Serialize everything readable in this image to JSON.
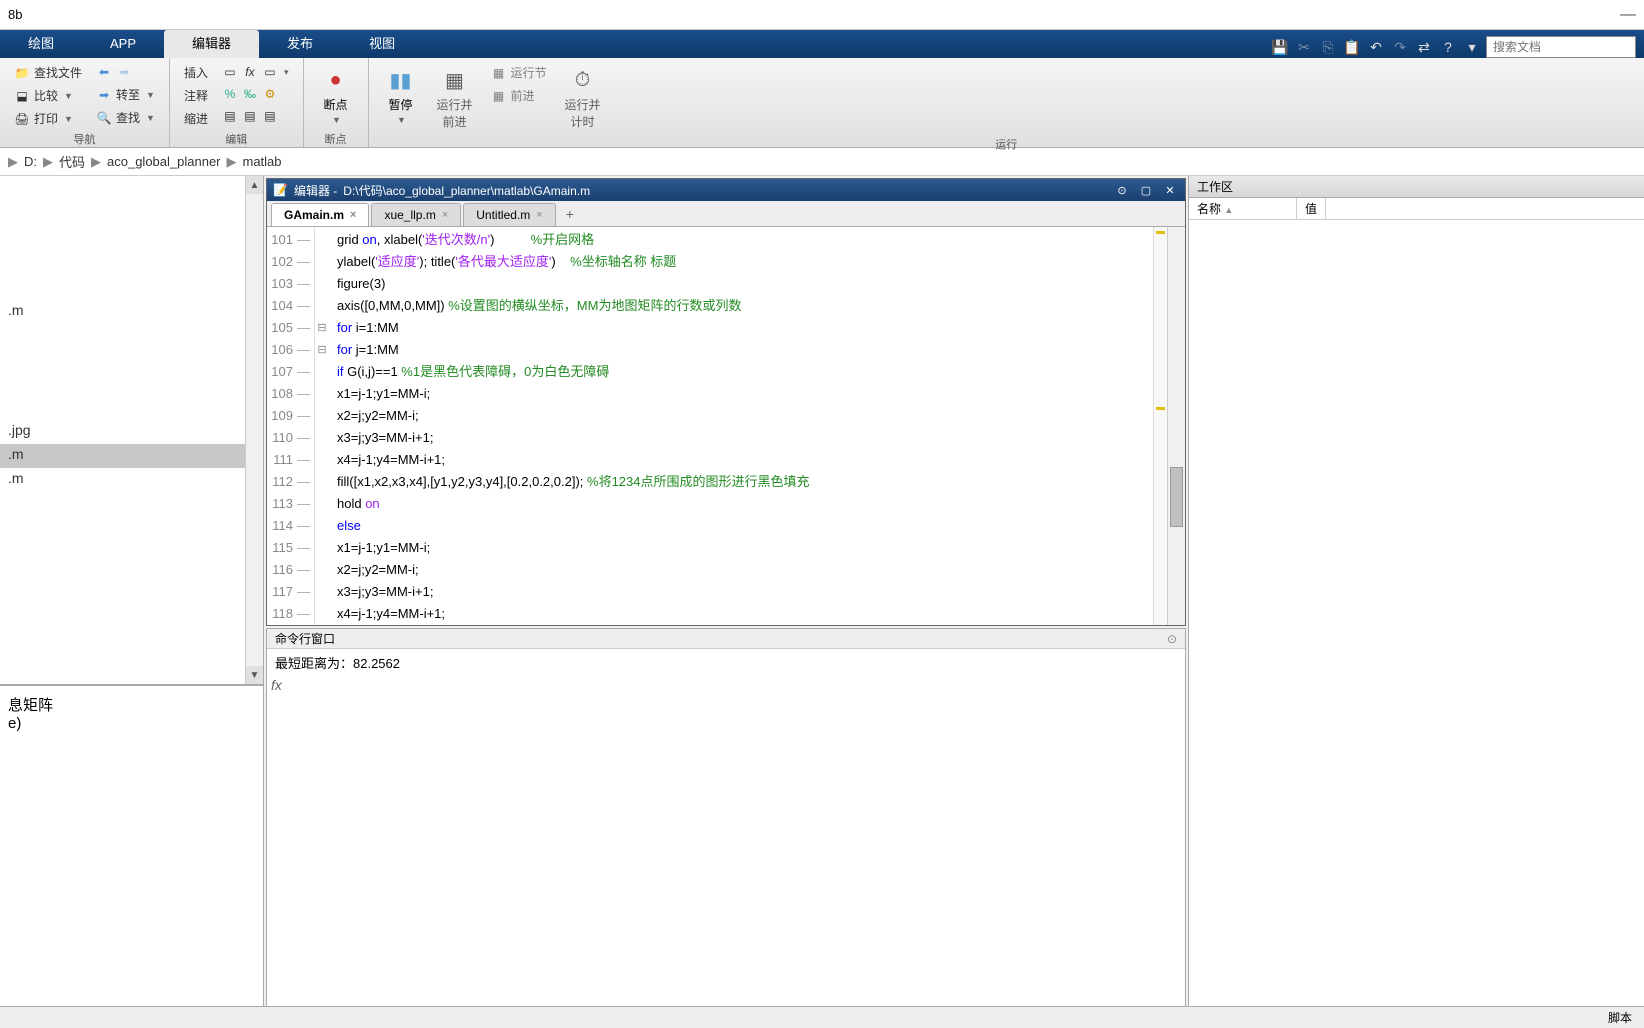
{
  "title_fragment": "8b",
  "tabs": {
    "plot": "绘图",
    "app": "APP",
    "editor": "编辑器",
    "publish": "发布",
    "view": "视图"
  },
  "search_placeholder": "搜索文档",
  "ribbon": {
    "nav": {
      "find_files": "查找文件",
      "compare": "比较",
      "print": "打印",
      "back": "",
      "goto": "转至",
      "find": "查找",
      "magnifier": "",
      "group": "导航"
    },
    "edit": {
      "insert": "插入",
      "comment": "注释",
      "indent": "缩进",
      "group": "编辑"
    },
    "breakpoint": {
      "label": "断点",
      "group": "断点"
    },
    "run": {
      "pause": "暂停",
      "run_advance": "运行并\n前进",
      "run_section": "运行节",
      "advance": "前进",
      "run_time": "运行并\n计时",
      "group": "运行"
    }
  },
  "breadcrumb": [
    "D:",
    "代码",
    "aco_global_planner",
    "matlab"
  ],
  "left_files": {
    "items": [
      "",
      "",
      "",
      "",
      "",
      ".m",
      "",
      "",
      "",
      "",
      ".jpg",
      ".m",
      ".m"
    ],
    "selected_index": 11
  },
  "left_bottom": {
    "l1": "息矩阵",
    "l2": "e)"
  },
  "editor": {
    "title_prefix": "编辑器 - ",
    "file_path": "D:\\代码\\aco_global_planner\\matlab\\GAmain.m",
    "tabs": [
      {
        "name": "GAmain.m",
        "active": true
      },
      {
        "name": "xue_llp.m",
        "active": false
      },
      {
        "name": "Untitled.m",
        "active": false
      }
    ],
    "first_line": 101,
    "lines": [
      {
        "n": 101,
        "dash": true,
        "text_parts": [
          {
            "t": "grid ",
            "c": ""
          },
          {
            "t": "on",
            "c": "kw"
          },
          {
            "t": ", xlabel(",
            "c": ""
          },
          {
            "t": "'迭代次数/n'",
            "c": "str"
          },
          {
            "t": ")          ",
            "c": ""
          },
          {
            "t": "%开启网格",
            "c": "cmt"
          }
        ],
        "hidden": true
      },
      {
        "n": 102,
        "dash": true,
        "text_parts": [
          {
            "t": "ylabel(",
            "c": ""
          },
          {
            "t": "'适应度'",
            "c": "str"
          },
          {
            "t": "); title(",
            "c": ""
          },
          {
            "t": "'各代最大适应度'",
            "c": "str"
          },
          {
            "t": ")    ",
            "c": ""
          },
          {
            "t": "%坐标轴名称 标题",
            "c": "cmt"
          }
        ]
      },
      {
        "n": 103,
        "dash": true,
        "text_parts": [
          {
            "t": "figure(3)",
            "c": ""
          }
        ]
      },
      {
        "n": 104,
        "dash": true,
        "text_parts": [
          {
            "t": "axis([0,MM,0,MM]) ",
            "c": ""
          },
          {
            "t": "%设置图的横纵坐标，MM为地图矩阵的行数或列数",
            "c": "cmt"
          }
        ]
      },
      {
        "n": 105,
        "dash": true,
        "fold": "⊟",
        "text_parts": [
          {
            "t": "for",
            "c": "kw"
          },
          {
            "t": " i=1:MM",
            "c": ""
          }
        ]
      },
      {
        "n": 106,
        "dash": true,
        "fold": "⊟",
        "text_parts": [
          {
            "t": "for",
            "c": "kw"
          },
          {
            "t": " j=1:MM",
            "c": ""
          }
        ]
      },
      {
        "n": 107,
        "dash": true,
        "text_parts": [
          {
            "t": "if",
            "c": "kw"
          },
          {
            "t": " G(i,j)==1 ",
            "c": ""
          },
          {
            "t": "%1是黑色代表障碍，0为白色无障碍",
            "c": "cmt"
          }
        ]
      },
      {
        "n": 108,
        "dash": true,
        "text_parts": [
          {
            "t": "x1=j-1;y1=MM-i;",
            "c": ""
          }
        ]
      },
      {
        "n": 109,
        "dash": true,
        "text_parts": [
          {
            "t": "x2=j;y2=MM-i;",
            "c": ""
          }
        ]
      },
      {
        "n": 110,
        "dash": true,
        "text_parts": [
          {
            "t": "x3=j;y3=MM-i+1;",
            "c": ""
          }
        ]
      },
      {
        "n": 111,
        "dash": true,
        "text_parts": [
          {
            "t": "x4=j-1;y4=MM-i+1;",
            "c": ""
          }
        ]
      },
      {
        "n": 112,
        "dash": true,
        "text_parts": [
          {
            "t": "fill([x1,x2,x3,x4],[y1,y2,y3,y4],[0.2,0.2,0.2]); ",
            "c": ""
          },
          {
            "t": "%将1234点所围成的图形进行黑色填充",
            "c": "cmt"
          }
        ]
      },
      {
        "n": 113,
        "dash": true,
        "text_parts": [
          {
            "t": "hold ",
            "c": ""
          },
          {
            "t": "on",
            "c": "str"
          }
        ]
      },
      {
        "n": 114,
        "dash": true,
        "text_parts": [
          {
            "t": "else",
            "c": "kw"
          }
        ]
      },
      {
        "n": 115,
        "dash": true,
        "text_parts": [
          {
            "t": "x1=j-1;y1=MM-i;",
            "c": ""
          }
        ]
      },
      {
        "n": 116,
        "dash": true,
        "text_parts": [
          {
            "t": "x2=j;y2=MM-i;",
            "c": ""
          }
        ]
      },
      {
        "n": 117,
        "dash": true,
        "text_parts": [
          {
            "t": "x3=j;y3=MM-i+1;",
            "c": ""
          }
        ]
      },
      {
        "n": 118,
        "dash": true,
        "text_parts": [
          {
            "t": "x4=j-1;y4=MM-i+1;",
            "c": ""
          }
        ]
      }
    ]
  },
  "cmd": {
    "title": "命令行窗口",
    "output": "最短距离为：82.2562",
    "prompt": "fx"
  },
  "workspace": {
    "title": "工作区",
    "col_name": "名称",
    "col_value": "值",
    "sort_icon": "▲"
  },
  "status": "脚本"
}
